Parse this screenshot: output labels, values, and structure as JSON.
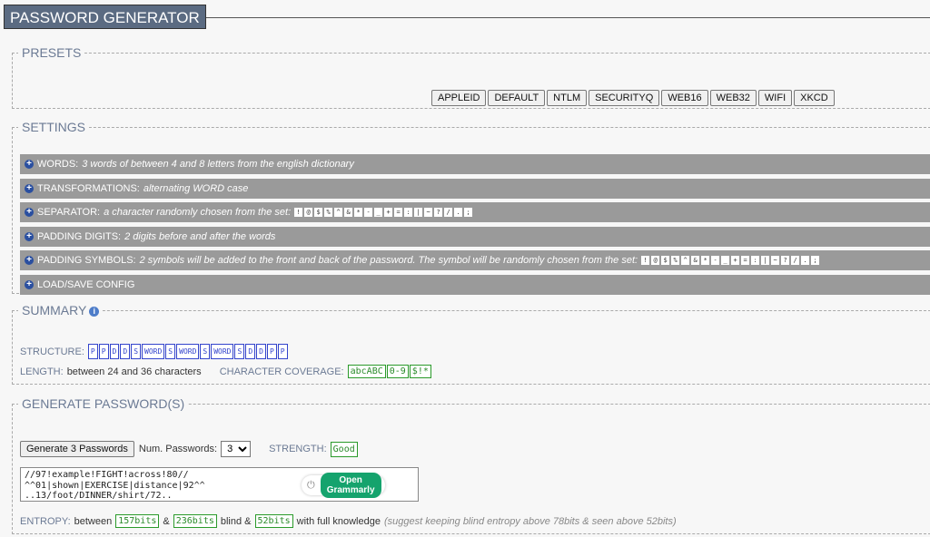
{
  "app_title": "PASSWORD GENERATOR",
  "presets": {
    "legend": "PRESETS",
    "buttons": [
      "APPLEID",
      "DEFAULT",
      "NTLM",
      "SECURITYQ",
      "WEB16",
      "WEB32",
      "WIFI",
      "XKCD"
    ]
  },
  "settings": {
    "legend": "SETTINGS",
    "rows": [
      {
        "label": "WORDS:",
        "desc": "3 words of between 4 and 8 letters from the english dictionary"
      },
      {
        "label": "TRANSFORMATIONS:",
        "desc": "alternating WORD case"
      },
      {
        "label": "SEPARATOR:",
        "desc": "a character randomly chosen from the set:"
      },
      {
        "label": "PADDING DIGITS:",
        "desc": "2 digits before and after the words"
      },
      {
        "label": "PADDING SYMBOLS:",
        "desc": "2 symbols will be added to the front and back of the password. The symbol will be randomly chosen from the set:"
      },
      {
        "label": "LOAD/SAVE CONFIG",
        "desc": ""
      }
    ],
    "separator_set": [
      "!",
      "@",
      "$",
      "%",
      "^",
      "&",
      "*",
      "-",
      "_",
      "+",
      "=",
      ":",
      "|",
      "~",
      "?",
      "/",
      ".",
      ";"
    ],
    "padding_symbol_set": [
      "!",
      "@",
      "$",
      "%",
      "^",
      "&",
      "*",
      "-",
      "_",
      "+",
      "=",
      ":",
      "|",
      "~",
      "?",
      "/",
      ".",
      ";"
    ]
  },
  "summary": {
    "legend": "SUMMARY",
    "structure_label": "STRUCTURE:",
    "structure": [
      "P",
      "P",
      "D",
      "D",
      "S",
      "WORD",
      "S",
      "WORD",
      "S",
      "WORD",
      "S",
      "D",
      "D",
      "P",
      "P"
    ],
    "length_label": "LENGTH:",
    "length_value": "between 24 and 36 characters",
    "coverage_label": "CHARACTER COVERAGE:",
    "coverage": [
      "abcABC",
      "0-9",
      "$!*"
    ]
  },
  "generate": {
    "legend": "GENERATE PASSWORD(S)",
    "button_label": "Generate 3 Passwords",
    "num_label": "Num. Passwords:",
    "num_value": "3",
    "strength_label": "STRENGTH:",
    "strength_value": "Good",
    "passwords_text": "//97!example!FIGHT!across!80//\n^^01|shown|EXERCISE|distance|92^^\n..13/foot/DINNER/shirt/72..",
    "grammarly_label": "Open Grammarly",
    "entropy_label": "ENTROPY:",
    "entropy_between": "between",
    "entropy_blind_min": "157bits",
    "entropy_amp1": "&",
    "entropy_blind_max": "236bits",
    "entropy_blind_text": "blind &",
    "entropy_seen": "52bits",
    "entropy_seen_text": "with full knowledge",
    "entropy_note": "(suggest keeping blind entropy above 78bits & seen above 52bits)"
  }
}
